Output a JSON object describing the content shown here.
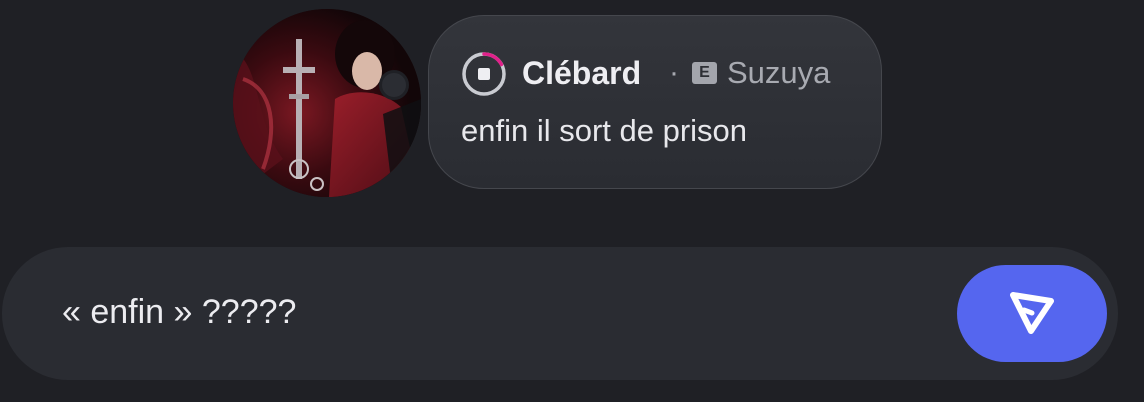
{
  "message": {
    "author": "Clébard",
    "separator": "·",
    "server_badge": "E",
    "server_name": "Suzuya",
    "text": "enfin il sort de prison"
  },
  "composer": {
    "value": "« enfin » ?????"
  },
  "icons": {
    "avatar": "user-avatar",
    "status": "status-ring-icon",
    "badge": "server-badge-icon",
    "send": "send-paper-plane-icon"
  },
  "colors": {
    "background": "#1f2025",
    "bubble": "#2e3036",
    "composer": "#2a2c32",
    "send_button": "#5566ef",
    "status_accent": "#e0218a"
  }
}
